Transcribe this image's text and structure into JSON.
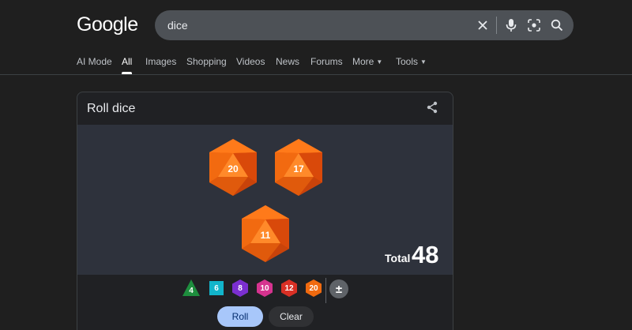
{
  "header": {
    "logo": "Google",
    "search": {
      "value": "dice"
    },
    "icons": [
      "clear-icon",
      "microphone-icon",
      "lens-icon",
      "search-icon"
    ]
  },
  "tabs": [
    {
      "label": "AI Mode",
      "active": false
    },
    {
      "label": "All",
      "active": true
    },
    {
      "label": "Images",
      "active": false
    },
    {
      "label": "Shopping",
      "active": false
    },
    {
      "label": "Videos",
      "active": false
    },
    {
      "label": "News",
      "active": false
    },
    {
      "label": "Forums",
      "active": false
    },
    {
      "label": "More",
      "active": false
    },
    {
      "label": "Tools",
      "active": false
    }
  ],
  "card": {
    "title": "Roll dice",
    "dice": [
      {
        "type": "d20",
        "value": "20"
      },
      {
        "type": "d20",
        "value": "17"
      },
      {
        "type": "d20",
        "value": "11"
      }
    ],
    "total_label": "Total",
    "total_value": "48",
    "picker": [
      {
        "label": "4",
        "color": "#1e8e3e"
      },
      {
        "label": "6",
        "color": "#12b5cb"
      },
      {
        "label": "8",
        "color": "#7b2fd0"
      },
      {
        "label": "10",
        "color": "#d6338f"
      },
      {
        "label": "12",
        "color": "#d93025"
      },
      {
        "label": "20",
        "color": "#f06a0f"
      }
    ],
    "modifier_label": "±",
    "roll_label": "Roll",
    "clear_label": "Clear"
  },
  "colors": {
    "background": "#1f1f1f",
    "board": "#2e323c",
    "die_orange": "#f06a0f",
    "roll_button": "#a8c7fa"
  }
}
